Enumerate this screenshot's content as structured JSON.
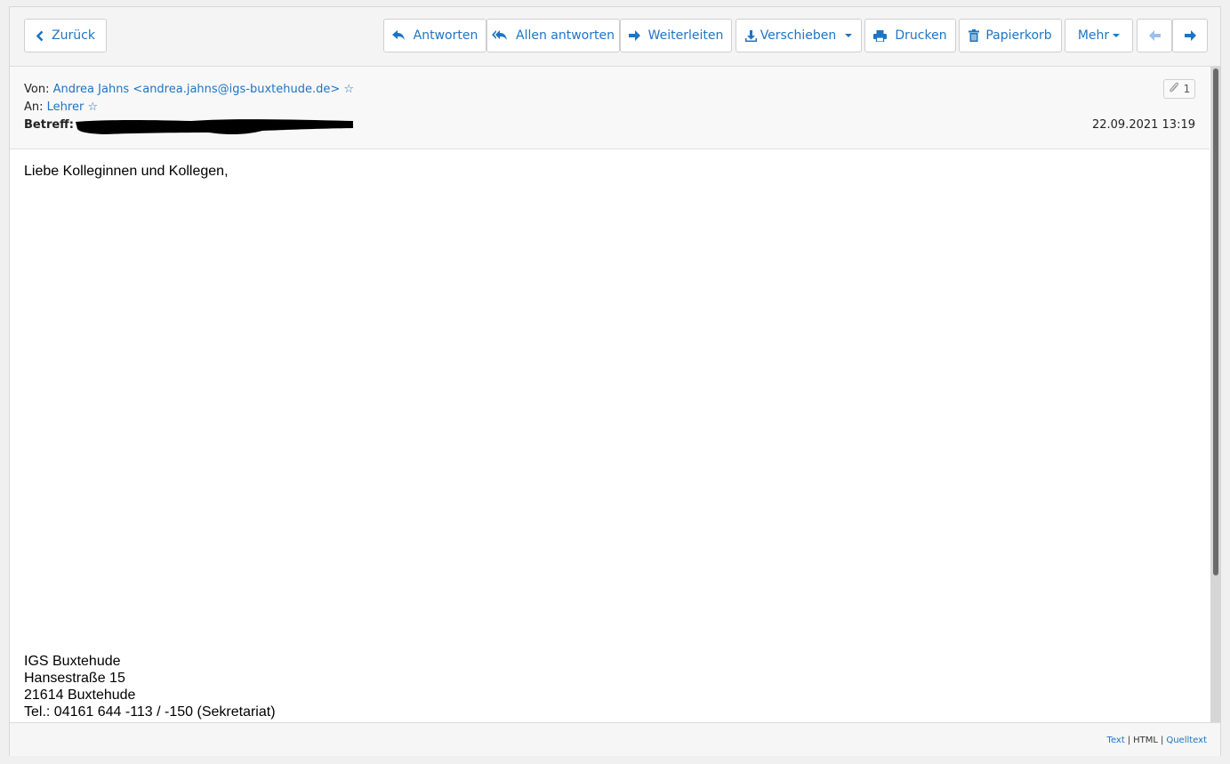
{
  "toolbar": {
    "back_label": "Zurück",
    "reply_label": "Antworten",
    "reply_all_label": "Allen antworten",
    "forward_label": "Weiterleiten",
    "move_label": "Verschieben",
    "print_label": "Drucken",
    "trash_label": "Papierkorb",
    "more_label": "Mehr"
  },
  "header": {
    "from_label": "Von:",
    "from_value": "Andrea Jahns <andrea.jahns@igs-buxtehude.de>",
    "to_label": "An:",
    "to_value": "Lehrer",
    "subject_label": "Betreff:",
    "date": "22.09.2021 13:19",
    "attachment_count": "1"
  },
  "message": {
    "greeting": "Liebe Kolleginnen und Kollegen,",
    "signature": [
      "IGS Buxtehude",
      "Hansestraße 15",
      "21614 Buxtehude",
      "Tel.: 04161 644 -113 / -150 (Sekretariat)"
    ]
  },
  "footer": {
    "text_link": "Text",
    "html_label": "HTML",
    "source_link": "Quelltext"
  },
  "colors": {
    "accent": "#1e74c4",
    "toolbar_bg": "#f4f4f4",
    "header_bg": "#f8f8f8"
  },
  "icons": [
    "chevron-left-icon",
    "reply-icon",
    "reply-all-icon",
    "forward-icon",
    "download-icon",
    "print-icon",
    "trash-icon",
    "arrow-left-icon",
    "arrow-right-icon",
    "star-icon",
    "paperclip-icon"
  ]
}
